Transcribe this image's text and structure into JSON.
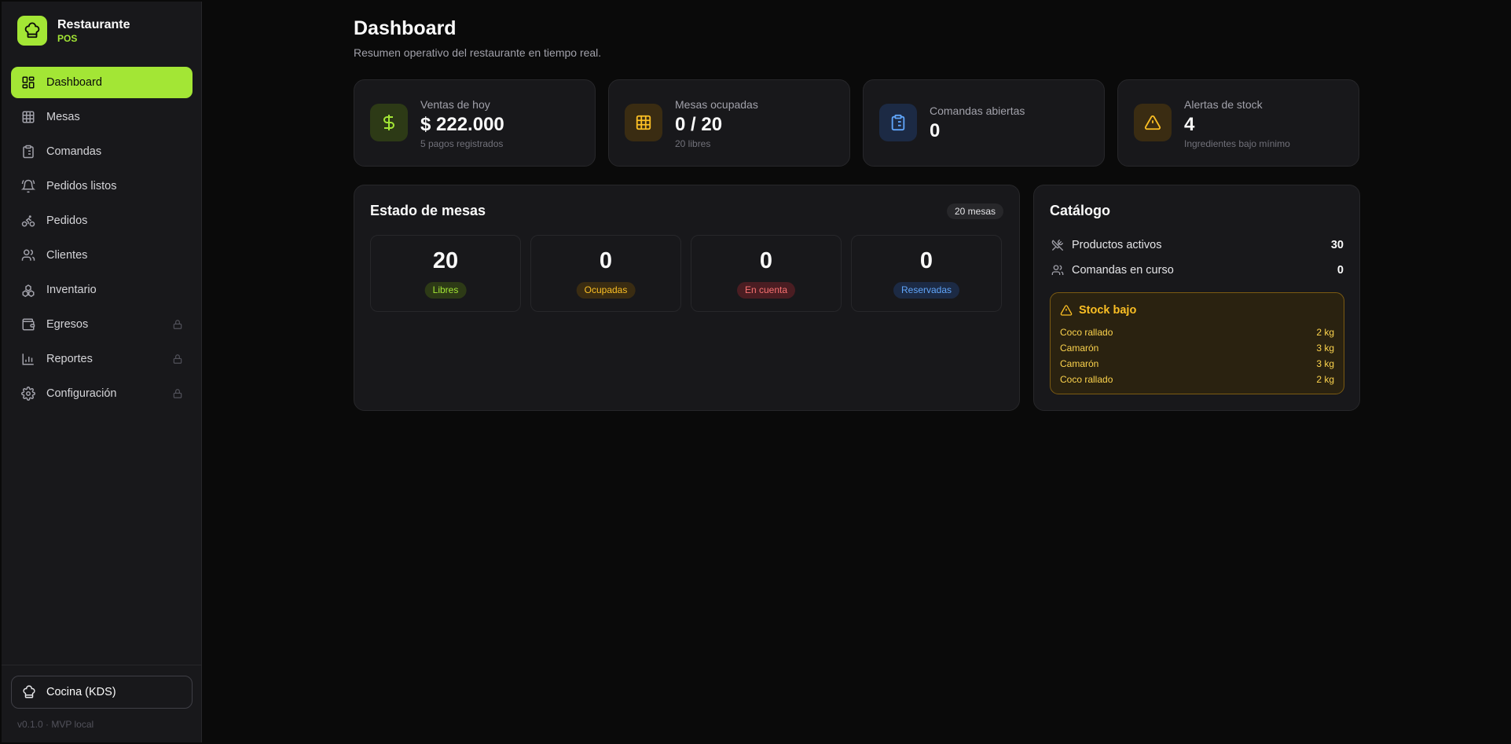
{
  "brand": {
    "title": "Restaurante",
    "subtitle": "POS"
  },
  "nav": {
    "items": [
      {
        "label": "Dashboard"
      },
      {
        "label": "Mesas"
      },
      {
        "label": "Comandas"
      },
      {
        "label": "Pedidos listos"
      },
      {
        "label": "Pedidos"
      },
      {
        "label": "Clientes"
      },
      {
        "label": "Inventario"
      },
      {
        "label": "Egresos"
      },
      {
        "label": "Reportes"
      },
      {
        "label": "Configuración"
      }
    ]
  },
  "footer": {
    "kds_label": "Cocina (KDS)",
    "version": "v0.1.0 · MVP local"
  },
  "header": {
    "title": "Dashboard",
    "subtitle": "Resumen operativo del restaurante en tiempo real."
  },
  "stats": [
    {
      "label": "Ventas de hoy",
      "value": "$ 222.000",
      "note": "5 pagos registrados",
      "color": "#a3e635"
    },
    {
      "label": "Mesas ocupadas",
      "value": "0 / 20",
      "note": "20 libres",
      "color": "#fbbf24"
    },
    {
      "label": "Comandas abiertas",
      "value": "0",
      "note": "",
      "color": "#60a5fa"
    },
    {
      "label": "Alertas de stock",
      "value": "4",
      "note": "Ingredientes bajo mínimo",
      "color": "#fbbf24"
    }
  ],
  "tables": {
    "title": "Estado de mesas",
    "badge": "20 mesas",
    "items": [
      {
        "count": "20",
        "label": "Libres",
        "color": "#a3e635"
      },
      {
        "count": "0",
        "label": "Ocupadas",
        "color": "#fbbf24"
      },
      {
        "count": "0",
        "label": "En cuenta",
        "color": "#f87171"
      },
      {
        "count": "0",
        "label": "Reservadas",
        "color": "#60a5fa"
      }
    ]
  },
  "catalog": {
    "title": "Catálogo",
    "rows": [
      {
        "label": "Productos activos",
        "value": "30"
      },
      {
        "label": "Comandas en curso",
        "value": "0"
      }
    ],
    "low_stock": {
      "title": "Stock bajo",
      "items": [
        {
          "name": "Coco rallado",
          "qty": "2 kg"
        },
        {
          "name": "Camarón",
          "qty": "3 kg"
        },
        {
          "name": "Camarón",
          "qty": "3 kg"
        },
        {
          "name": "Coco rallado",
          "qty": "2 kg"
        }
      ]
    }
  }
}
